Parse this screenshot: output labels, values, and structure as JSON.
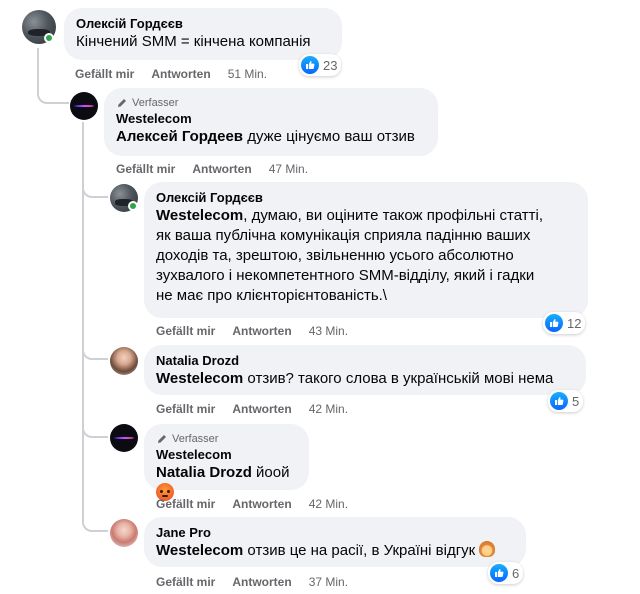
{
  "actions": {
    "like": "Gefällt mir",
    "reply": "Antworten"
  },
  "author_badge": "Verfasser",
  "comments": [
    {
      "name": "Олексій Гордєєв",
      "text": "Кінчений SMM = кінчена компанія",
      "time": "51 Min.",
      "reactions": "23"
    },
    {
      "name": "Westelecom",
      "mention": "Алексей Гордеев",
      "text": " дуже цінуємо ваш отзив",
      "time": "47 Min."
    },
    {
      "name": "Олексій Гордєєв",
      "mention": "Westelecom",
      "text_lines": [
        ", думаю, ви оціните також профільні статті,",
        "як ваша публічна комунікація сприяла падінню ваших",
        "доходів та, зрештою, звільненню усього абсолютно",
        "зухвалого і некомпетентного SMM-відділу, який і гадки",
        "не має про клієнторієнтованість.\\"
      ],
      "time": "43 Min.",
      "reactions": "12"
    },
    {
      "name": "Natalia Drozd",
      "mention": "Westelecom",
      "text": " отзив? такого слова в українській мові нема",
      "time": "42 Min.",
      "reactions": "5"
    },
    {
      "name": "Westelecom",
      "mention": "Natalia Drozd",
      "text": " йоой",
      "time": "42 Min."
    },
    {
      "name": "Jane Pro",
      "mention": "Westelecom",
      "text": " отзив це на расії, в Україні відгук",
      "time": "37 Min.",
      "reactions": "6"
    }
  ]
}
